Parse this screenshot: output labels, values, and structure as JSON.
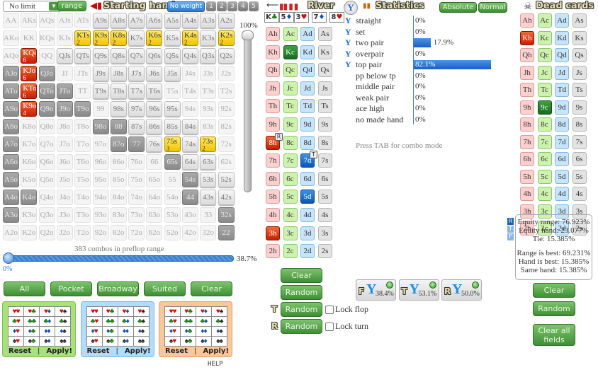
{
  "toolbar": {
    "limit_select": "No limit",
    "range_button": "range",
    "starting_hand_title": "Starting hand",
    "weight_button": "No weight",
    "weight_levels": [
      "1",
      "2",
      "3",
      "4",
      "5"
    ]
  },
  "range_grid": {
    "rows": [
      [
        "AA",
        "AKs",
        "AQs",
        "AJs",
        "ATs",
        "A9s",
        "A8s",
        "A7s",
        "A6s",
        "A5s",
        "A4s",
        "A3s",
        "A2s"
      ],
      [
        "AKo",
        "KK",
        "KQs",
        "KJs",
        "KTs",
        "K9s",
        "K8s",
        "K7s",
        "K6s",
        "K5s",
        "K4s",
        "K3s",
        "K2s"
      ],
      [
        "AQo",
        "KQo",
        "QQ",
        "QJs",
        "QTs",
        "Q9s",
        "Q8s",
        "Q7s",
        "Q6s",
        "Q5s",
        "Q4s",
        "Q3s",
        "Q2s"
      ],
      [
        "AJo",
        "KJo",
        "QJo",
        "JJ",
        "JTs",
        "J9s",
        "J8s",
        "J7s",
        "J6s",
        "J5s",
        "J4s",
        "J3s",
        "J2s"
      ],
      [
        "ATo",
        "KTo",
        "QTo",
        "JTo",
        "TT",
        "T9s",
        "T8s",
        "T7s",
        "T6s",
        "T5s",
        "T4s",
        "T3s",
        "T2s"
      ],
      [
        "A9o",
        "K9o",
        "Q9o",
        "J9o",
        "T9o",
        "99",
        "98s",
        "97s",
        "96s",
        "95s",
        "94s",
        "93s",
        "92s"
      ],
      [
        "A8o",
        "K8o",
        "Q8o",
        "J8o",
        "T8o",
        "98o",
        "88",
        "87s",
        "86s",
        "85s",
        "84s",
        "83s",
        "82s"
      ],
      [
        "A7o",
        "K7o",
        "Q7o",
        "J7o",
        "T7o",
        "97o",
        "87o",
        "77",
        "76s",
        "75s",
        "74s",
        "73s",
        "72s"
      ],
      [
        "A6o",
        "K6o",
        "Q6o",
        "J6o",
        "T6o",
        "96o",
        "86o",
        "76o",
        "66",
        "65s",
        "64s",
        "63s",
        "62s"
      ],
      [
        "A5o",
        "K5o",
        "Q5o",
        "J5o",
        "T5o",
        "95o",
        "85o",
        "75o",
        "65o",
        "55",
        "54s",
        "53s",
        "52s"
      ],
      [
        "A4o",
        "K4o",
        "Q4o",
        "J4o",
        "T4o",
        "94o",
        "84o",
        "74o",
        "64o",
        "54o",
        "44",
        "43s",
        "42s"
      ],
      [
        "A3o",
        "K3o",
        "Q3o",
        "J3o",
        "T3o",
        "93o",
        "83o",
        "73o",
        "63o",
        "53o",
        "43o",
        "33",
        "32s"
      ],
      [
        "A2o",
        "K2o",
        "Q2o",
        "J2o",
        "T2o",
        "92o",
        "82o",
        "72o",
        "62o",
        "52o",
        "42o",
        "32o",
        "22"
      ]
    ],
    "states": [
      "fffffnnnnnnnn",
      "ffffyyynynyny",
      "frfnnnnnnnnnn",
      "drdffnnnnnfff",
      "drddfnnnnffff",
      "drdddfnnnnfff",
      "dffffddnnnnff",
      "dfffffddnynyf",
      "dffffffffdnnf",
      "dfffffffffdnn",
      "ddffffffffdnn",
      "dfffffffffffd",
      "ffffffffffffd"
    ],
    "counts": {
      "KTs": "2",
      "K9s": "2",
      "K8s": "2",
      "K6s": "2",
      "K4s": "2",
      "K2s": "2",
      "KQo": "6",
      "KJo": "6",
      "KTo": "6",
      "K9o": "4",
      "75s": "3",
      "73s": "2"
    },
    "combos_text": "383 combos in preflop range",
    "range_percent": "38.7%",
    "slider_min": "0%",
    "weight_slider": "100%"
  },
  "range_buttons": [
    "All",
    "Pocket",
    "Broadway",
    "Suited",
    "Clear"
  ],
  "suit_panels": [
    {
      "color": "#a8e07a",
      "border": "#7cc05a",
      "reset": "Reset",
      "sep": "|",
      "apply": "Apply!"
    },
    {
      "color": "#b4dcf8",
      "border": "#80b8e0",
      "reset": "Reset",
      "sep": "|",
      "apply": "Apply!"
    },
    {
      "color": "#f9c89a",
      "border": "#e0a070",
      "reset": "Reset",
      "sep": "|",
      "apply": "Apply!"
    }
  ],
  "help_link": "HELP",
  "board": {
    "title": "River",
    "cards": [
      {
        "rank": "K",
        "suit": "♣",
        "color": "#1a7a1a"
      },
      {
        "rank": "5",
        "suit": "♦",
        "color": "#1050b0"
      },
      {
        "rank": "3",
        "suit": "♥",
        "color": "#d01010"
      },
      {
        "rank": "7",
        "suit": "♦",
        "color": "#1050b0"
      },
      {
        "rank": "8",
        "suit": "♥",
        "color": "#d01010"
      }
    ],
    "ranks": [
      "A",
      "K",
      "Q",
      "J",
      "T",
      "9",
      "8",
      "7",
      "6",
      "5",
      "4",
      "3",
      "2"
    ],
    "suits": [
      "h",
      "c",
      "d",
      "s"
    ],
    "selected": {
      "Kc": "",
      "8h": "R",
      "7d": "T",
      "5d": "",
      "3h": ""
    },
    "clear": "Clear",
    "random": "Random",
    "turn_label": "T",
    "river_label": "R",
    "turn_random": "Random",
    "river_random": "Random",
    "lock_flop": "Lock flop",
    "lock_turn": "Lock turn"
  },
  "statistics": {
    "title": "Statistics",
    "absolute": "Absolute",
    "normal": "Normal",
    "rows": [
      {
        "label": "straight",
        "value": "0%",
        "pct": 0,
        "filter": true
      },
      {
        "label": "set",
        "value": "0%",
        "pct": 0,
        "filter": true
      },
      {
        "label": "two pair",
        "value": "17.9%",
        "pct": 17.9,
        "filter": true
      },
      {
        "label": "overpair",
        "value": "0%",
        "pct": 0,
        "filter": true
      },
      {
        "label": "top pair",
        "value": "82.1%",
        "pct": 82.1,
        "filter": true
      },
      {
        "label": "pp below tp",
        "value": "0%",
        "pct": 0,
        "filter": false
      },
      {
        "label": "middle pair",
        "value": "0%",
        "pct": 0,
        "filter": false
      },
      {
        "label": "weak pair",
        "value": "0%",
        "pct": 0,
        "filter": false
      },
      {
        "label": "ace high",
        "value": "0%",
        "pct": 0,
        "filter": false
      },
      {
        "label": "no made hand",
        "value": "0%",
        "pct": 0,
        "filter": false
      }
    ],
    "hint": "Press TAB for combo mode",
    "filters": [
      {
        "street": "F",
        "value": "38.4%"
      },
      {
        "street": "T",
        "value": "53.1%"
      },
      {
        "street": "R",
        "value": "50.0%"
      }
    ]
  },
  "dead_cards": {
    "title": "Dead cards",
    "selected": {
      "Kh": "",
      "9c": ""
    },
    "street_tabs": [
      "R",
      "T",
      "F"
    ],
    "equity": [
      "Equity range: 76.923%",
      "Equity hand: 23.077%",
      "Tie: 15.385%"
    ],
    "best": [
      "Range is best: 69.231%",
      "Hand is best: 15.385%",
      "Same hand: 15.385%"
    ],
    "clear": "Clear",
    "random": "Random",
    "clear_all": "Clear all fields"
  }
}
